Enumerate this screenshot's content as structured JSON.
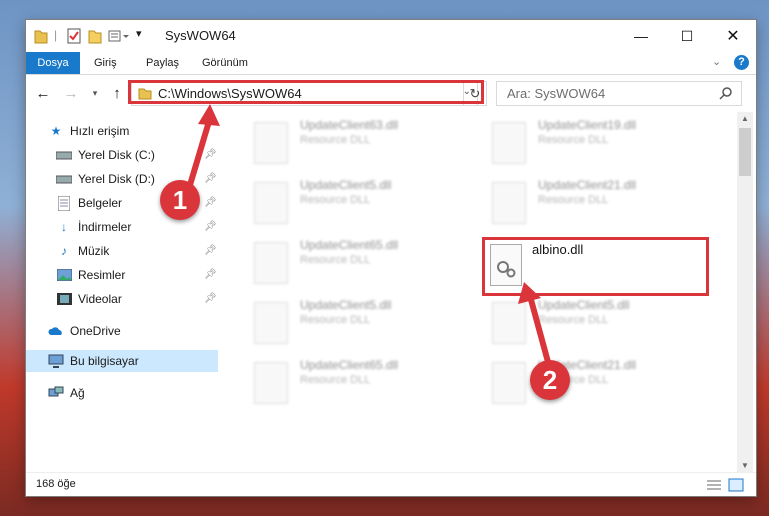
{
  "window": {
    "title": "SysWOW64"
  },
  "ribbon": {
    "tabs": [
      "Dosya",
      "Giriş",
      "Paylaş",
      "Görünüm"
    ]
  },
  "address": {
    "path": "C:\\Windows\\SysWOW64"
  },
  "search": {
    "placeholder": "Ara: SysWOW64"
  },
  "sidebar": {
    "items": [
      {
        "label": "Hızlı erişim",
        "icon": "star-icon"
      },
      {
        "label": "Yerel Disk (C:)",
        "icon": "drive-icon"
      },
      {
        "label": "Yerel Disk (D:)",
        "icon": "drive-icon"
      },
      {
        "label": "Belgeler",
        "icon": "documents-icon"
      },
      {
        "label": "İndirmeler",
        "icon": "download-icon"
      },
      {
        "label": "Müzik",
        "icon": "music-icon"
      },
      {
        "label": "Resimler",
        "icon": "pictures-icon"
      },
      {
        "label": "Videolar",
        "icon": "video-icon"
      },
      {
        "label": "OneDrive",
        "icon": "cloud-icon"
      },
      {
        "label": "Bu bilgisayar",
        "icon": "computer-icon"
      },
      {
        "label": "Ağ",
        "icon": "network-icon"
      }
    ]
  },
  "files": [
    {
      "name": "UpdateClient63.dll",
      "desc": "Resource DLL"
    },
    {
      "name": "UpdateClient19.dll",
      "desc": "Resource DLL"
    },
    {
      "name": "UpdateClient5.dll",
      "desc": "Resource DLL"
    },
    {
      "name": "UpdateClient21.dll",
      "desc": "Resource DLL"
    },
    {
      "name": "UpdateClient65.dll",
      "desc": "Resource DLL"
    },
    {
      "name": "albino.dll",
      "desc": ""
    },
    {
      "name": "UpdateClient5.dll",
      "desc": "Resource DLL"
    },
    {
      "name": "UpdateClient5.dll",
      "desc": "Resource DLL"
    },
    {
      "name": "UpdateClient65.dll",
      "desc": "Resource DLL"
    },
    {
      "name": "UpdateClient21.dll",
      "desc": "Resource DLL"
    }
  ],
  "annotations": [
    "1",
    "2"
  ],
  "status": {
    "count": "168 öğe"
  },
  "colors": {
    "accent": "#1979ca",
    "highlight": "#d9353b",
    "selection": "#cce8ff"
  }
}
